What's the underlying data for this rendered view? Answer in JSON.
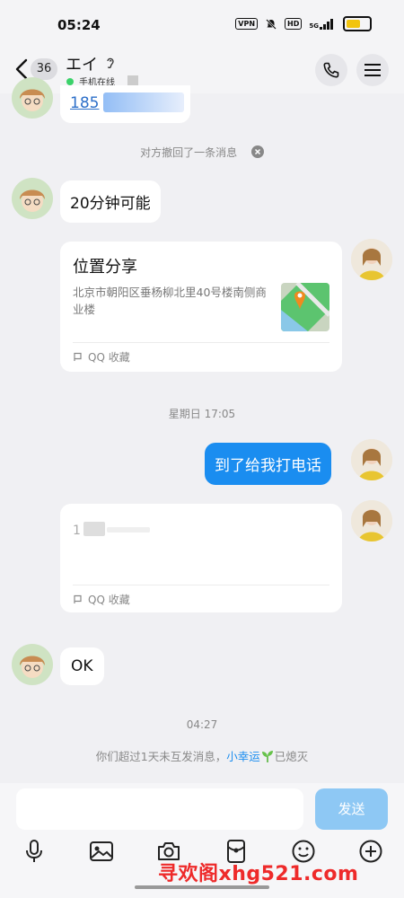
{
  "status": {
    "time": "05:24",
    "vpn": "VPN",
    "hd": "HD",
    "net": "5G"
  },
  "header": {
    "unread_count": "36",
    "title": "エイ",
    "online_text": "手机在线"
  },
  "chat": {
    "partial_message": "185",
    "system_recall": "对方撤回了一条消息",
    "msg1": "20分钟可能",
    "location_card": {
      "title": "位置分享",
      "address": "北京市朝阳区垂杨柳北里40号楼南侧商业楼",
      "footer": "QQ 收藏"
    },
    "timestamp1": "星期日 17:05",
    "msg_sent": "到了给我打电话",
    "card2": {
      "text": "1",
      "footer": "QQ 收藏"
    },
    "msg_ok": "OK",
    "timestamp2": "04:27",
    "spark_prefix": "你们超过1天未互发消息，",
    "spark_link": "小幸运",
    "spark_suffix": "已熄灭"
  },
  "input": {
    "send_label": "发送",
    "placeholder": ""
  },
  "watermark": "寻欢阁xhg521.com",
  "colors": {
    "accent": "#1a8df0",
    "send_disabled": "#8ec8f4",
    "online": "#3bd26a",
    "watermark": "#ee2a2a"
  }
}
